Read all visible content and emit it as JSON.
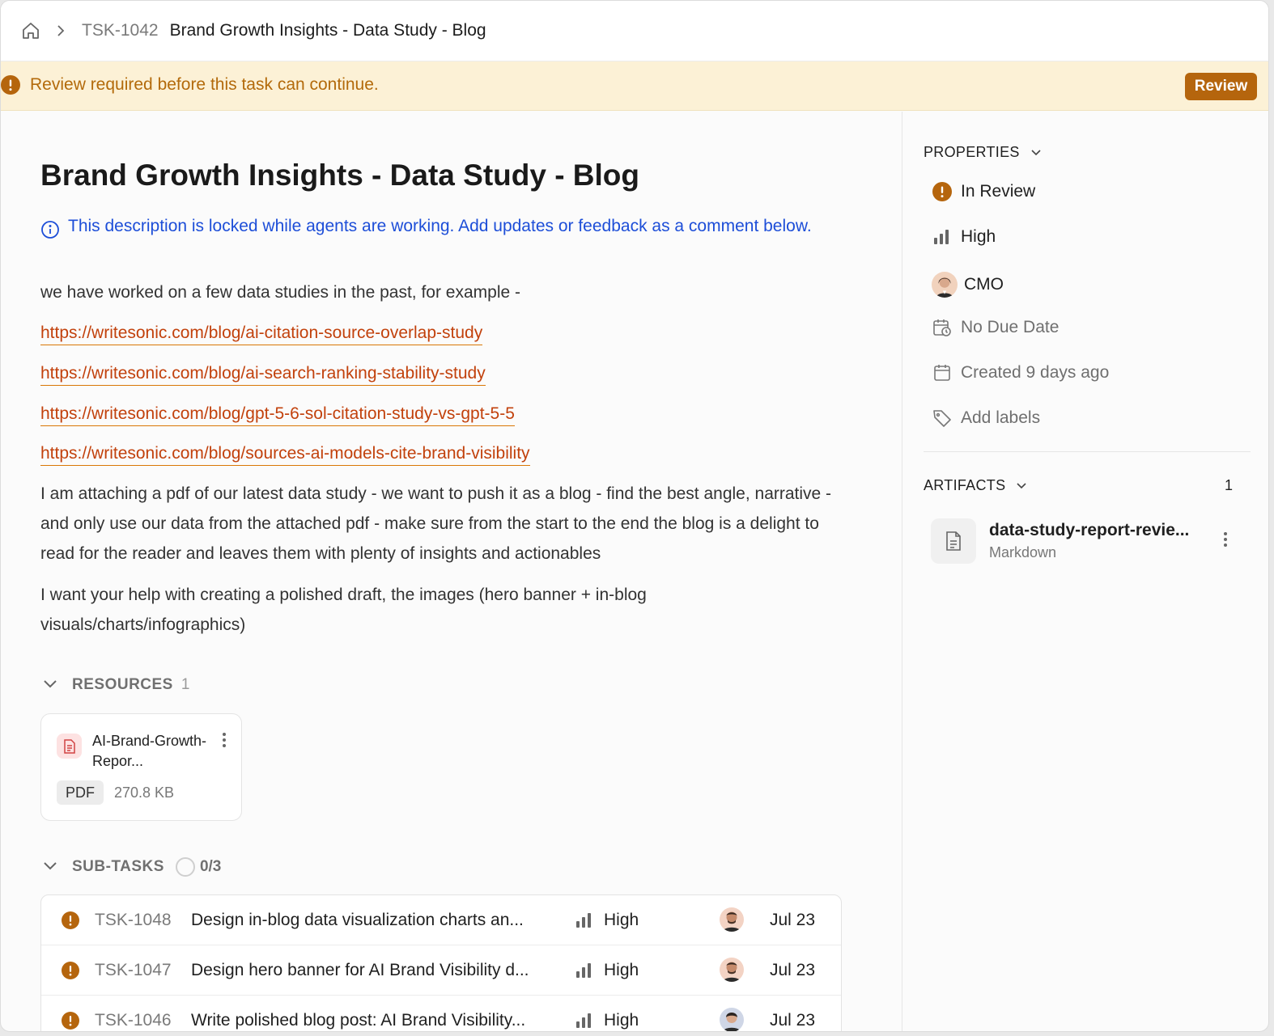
{
  "breadcrumb": {
    "task_id": "TSK-1042",
    "title": "Brand Growth Insights - Data Study - Blog"
  },
  "banner": {
    "text": "Review required before this task can continue.",
    "button_label": "Review"
  },
  "task": {
    "title": "Brand Growth Insights - Data Study - Blog",
    "locked_notice": "This description is locked while agents are working. Add updates or feedback as a comment below.",
    "intro": "we have worked on a few data studies in the past, for example -",
    "links": [
      "https://writesonic.com/blog/ai-citation-source-overlap-study",
      "https://writesonic.com/blog/ai-search-ranking-stability-study",
      "https://writesonic.com/blog/gpt-5-6-sol-citation-study-vs-gpt-5-5",
      "https://writesonic.com/blog/sources-ai-models-cite-brand-visibility"
    ],
    "paragraph_1": "I am attaching a pdf of our latest data study - we want to push it as a blog - find the best angle, narrative - and only use our data from the attached pdf - make sure from the start to the end the blog is a delight to read for the reader and leaves them with plenty of insights and actionables",
    "paragraph_2": "I want your help with creating a polished draft, the images (hero banner + in-blog visuals/charts/infographics)"
  },
  "resources": {
    "label": "RESOURCES",
    "count": "1",
    "items": [
      {
        "name": "AI-Brand-Growth-Repor...",
        "type": "PDF",
        "size": "270.8 KB"
      }
    ]
  },
  "subtasks": {
    "label": "SUB-TASKS",
    "progress": "0/3",
    "items": [
      {
        "id": "TSK-1048",
        "title": "Design in-blog data visualization charts an...",
        "priority": "High",
        "date": "Jul 23"
      },
      {
        "id": "TSK-1047",
        "title": "Design hero banner for AI Brand Visibility d...",
        "priority": "High",
        "date": "Jul 23"
      },
      {
        "id": "TSK-1046",
        "title": "Write polished blog post: AI Brand Visibility...",
        "priority": "High",
        "date": "Jul 23"
      }
    ]
  },
  "properties": {
    "label": "PROPERTIES",
    "status": "In Review",
    "priority": "High",
    "assignee": "CMO",
    "due_date": "No Due Date",
    "created": "Created 9 days ago",
    "labels": "Add labels"
  },
  "artifacts": {
    "label": "ARTIFACTS",
    "count": "1",
    "items": [
      {
        "name": "data-study-report-revie...",
        "type": "Markdown"
      }
    ]
  },
  "colors": {
    "accent": "#b5650d",
    "warning_bg": "#fcf1d6",
    "link": "#c2410c",
    "info": "#1d4ed8"
  }
}
